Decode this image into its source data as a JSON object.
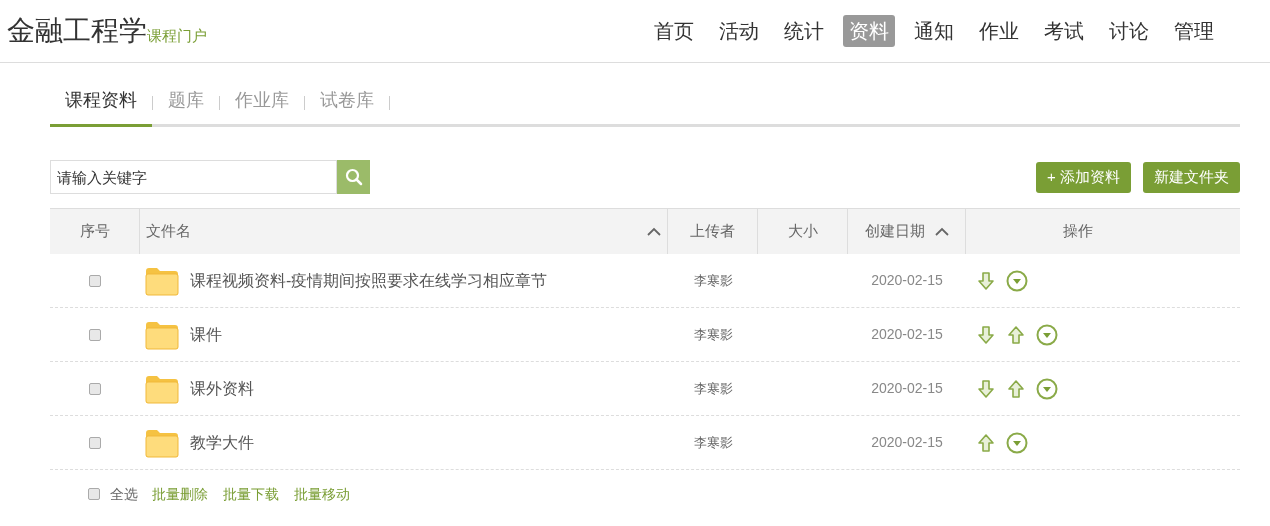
{
  "header": {
    "title": "金融工程学",
    "subtitle": "课程门户",
    "nav": [
      {
        "label": "首页",
        "selected": false
      },
      {
        "label": "活动",
        "selected": false
      },
      {
        "label": "统计",
        "selected": false
      },
      {
        "label": "资料",
        "selected": true
      },
      {
        "label": "通知",
        "selected": false
      },
      {
        "label": "作业",
        "selected": false
      },
      {
        "label": "考试",
        "selected": false
      },
      {
        "label": "讨论",
        "selected": false
      },
      {
        "label": "管理",
        "selected": false
      }
    ]
  },
  "tabs": [
    {
      "label": "课程资料",
      "selected": true
    },
    {
      "label": "题库",
      "selected": false
    },
    {
      "label": "作业库",
      "selected": false
    },
    {
      "label": "试卷库",
      "selected": false
    }
  ],
  "search": {
    "placeholder": "请输入关键字"
  },
  "buttons": [
    {
      "label": "+ 添加资料"
    },
    {
      "label": "新建文件夹"
    }
  ],
  "table": {
    "columns": [
      {
        "label": "序号",
        "sortable": false
      },
      {
        "label": "文件名",
        "sortable": true
      },
      {
        "label": "上传者",
        "sortable": false
      },
      {
        "label": "大小",
        "sortable": false
      },
      {
        "label": "创建日期",
        "sortable": true
      },
      {
        "label": "操作",
        "sortable": false
      }
    ],
    "rows": [
      {
        "checked": false,
        "name": "课程视频资料-疫情期间按照要求在线学习相应章节",
        "uploader": "李寒影",
        "date": "2020-02-15",
        "actions": [
          {
            "kind": "down"
          },
          {
            "kind": "menu"
          }
        ]
      },
      {
        "checked": false,
        "name": "课件",
        "uploader": "李寒影",
        "date": "2020-02-15",
        "actions": [
          {
            "kind": "down"
          },
          {
            "kind": "up"
          },
          {
            "kind": "menu"
          }
        ]
      },
      {
        "checked": false,
        "name": "课外资料",
        "uploader": "李寒影",
        "date": "2020-02-15",
        "actions": [
          {
            "kind": "down"
          },
          {
            "kind": "up"
          },
          {
            "kind": "menu"
          }
        ]
      },
      {
        "checked": false,
        "name": "教学大件",
        "uploader": "李寒影",
        "date": "2020-02-15",
        "actions": [
          {
            "kind": "up"
          },
          {
            "kind": "menu"
          }
        ]
      }
    ]
  },
  "footer": {
    "select_all": {
      "label": "全选",
      "checked": false
    },
    "links": [
      "批量删除",
      "批量下载",
      "批量移动"
    ]
  }
}
